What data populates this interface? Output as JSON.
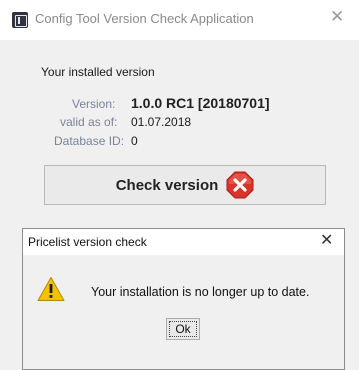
{
  "window": {
    "title": "Config Tool Version Check Application",
    "close_glyph": "✕"
  },
  "info": {
    "heading": "Your installed version",
    "version_label": "Version:",
    "version_value": "1.0.0 RC1 [20180701]",
    "valid_label": "valid as of:",
    "valid_value": "01.07.2018",
    "db_label": "Database ID:",
    "db_value": "0"
  },
  "check_button": {
    "label": "Check version",
    "icon": "error-x-icon",
    "icon_color": "#d9342b"
  },
  "dialog": {
    "title": "Pricelist version check",
    "close_glyph": "✕",
    "message": "Your installation is no longer up to date.",
    "icon": "warning-icon",
    "icon_color": "#f2c200",
    "ok_label": "Ok"
  }
}
